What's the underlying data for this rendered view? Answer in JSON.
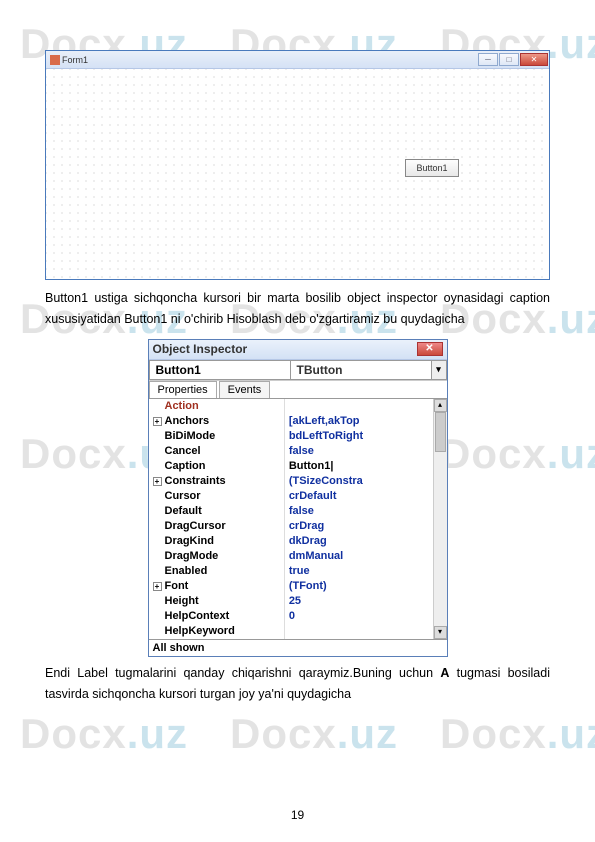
{
  "watermark": "Docx",
  "watermark_suffix": ".uz",
  "form": {
    "title": "Form1",
    "button_label": "Button1"
  },
  "paragraph1": "Button1 ustiga sichqoncha kursori bir marta bosilib object inspector oynasidagi caption xususiyatidan Button1 ni o'chirib Hisoblash deb o'zgartiramiz bu quydagicha",
  "oi": {
    "title": "Object Inspector",
    "selector_name": "Button1",
    "selector_type": "TButton",
    "tab_properties": "Properties",
    "tab_events": "Events",
    "rows": [
      {
        "key": "Action",
        "val": "",
        "cls": "action"
      },
      {
        "key": "Anchors",
        "val": "[akLeft,akTop",
        "exp": true
      },
      {
        "key": "BiDiMode",
        "val": "bdLeftToRight"
      },
      {
        "key": "Cancel",
        "val": "false"
      },
      {
        "key": "Caption",
        "val": "Button1|",
        "valcls": "black"
      },
      {
        "key": "Constraints",
        "val": "(TSizeConstra",
        "exp": true
      },
      {
        "key": "Cursor",
        "val": "crDefault"
      },
      {
        "key": "Default",
        "val": "false"
      },
      {
        "key": "DragCursor",
        "val": "crDrag"
      },
      {
        "key": "DragKind",
        "val": "dkDrag"
      },
      {
        "key": "DragMode",
        "val": "dmManual"
      },
      {
        "key": "Enabled",
        "val": "true"
      },
      {
        "key": "Font",
        "val": "(TFont)",
        "exp": true
      },
      {
        "key": "Height",
        "val": "25"
      },
      {
        "key": "HelpContext",
        "val": "0"
      },
      {
        "key": "HelpKeyword",
        "val": ""
      }
    ],
    "status": "All shown"
  },
  "paragraph2_pre": "Endi Label tugmalarini qanday chiqarishni qaraymiz.Buning uchun ",
  "paragraph2_bold": "A",
  "paragraph2_post": " tugmasi bosiladi tasvirda sichqoncha kursori turgan joy ya'ni quydagicha",
  "page_number": "19"
}
